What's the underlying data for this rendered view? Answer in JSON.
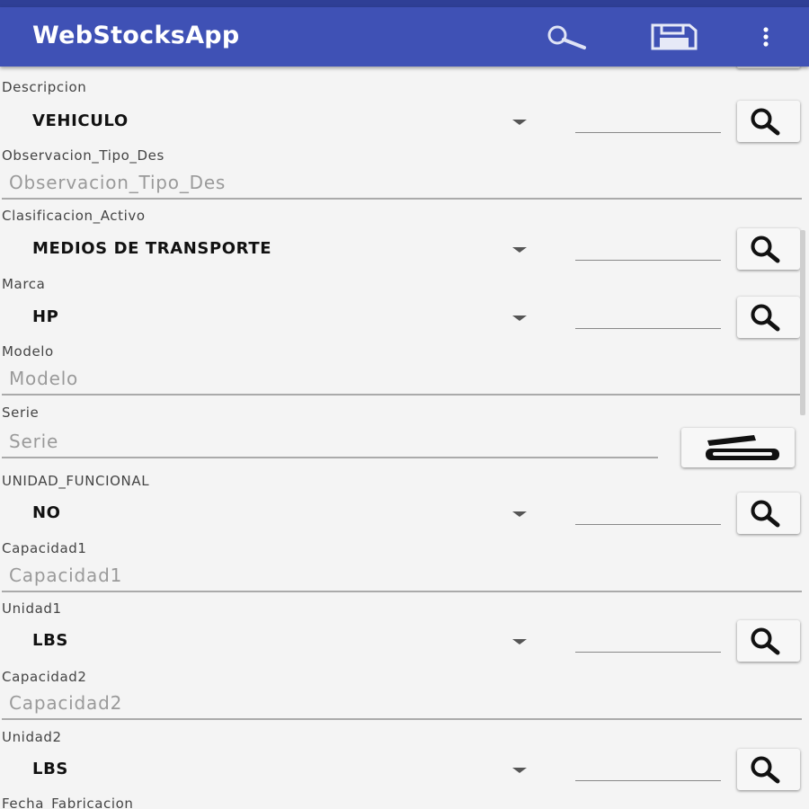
{
  "app": {
    "title": "WebStocksApp",
    "theme_color": "#3f51b5"
  },
  "toolbar": {
    "search_icon": "search-icon",
    "save_icon": "save-disk-icon",
    "menu_icon": "more-vert-icon"
  },
  "form": {
    "descripcion": {
      "label": "Descripcion",
      "value": "VEHICULO"
    },
    "observacion_tipo_des": {
      "label": "Observacion_Tipo_Des",
      "placeholder": "Observacion_Tipo_Des"
    },
    "clasificacion_activo": {
      "label": "Clasificacion_Activo",
      "value": "MEDIOS DE TRANSPORTE"
    },
    "marca": {
      "label": "Marca",
      "value": "HP"
    },
    "modelo": {
      "label": "Modelo",
      "placeholder": "Modelo"
    },
    "serie": {
      "label": "Serie",
      "placeholder": "Serie",
      "scan_icon": "barcode-scanner-icon"
    },
    "unidad_funcional": {
      "label": "UNIDAD_FUNCIONAL",
      "value": "NO"
    },
    "capacidad1": {
      "label": "Capacidad1",
      "placeholder": "Capacidad1"
    },
    "unidad1": {
      "label": "Unidad1",
      "value": "LBS"
    },
    "capacidad2": {
      "label": "Capacidad2",
      "placeholder": "Capacidad2"
    },
    "unidad2": {
      "label": "Unidad2",
      "value": "LBS"
    },
    "fecha_fabricacion": {
      "label": "Fecha_Fabricacion"
    }
  }
}
